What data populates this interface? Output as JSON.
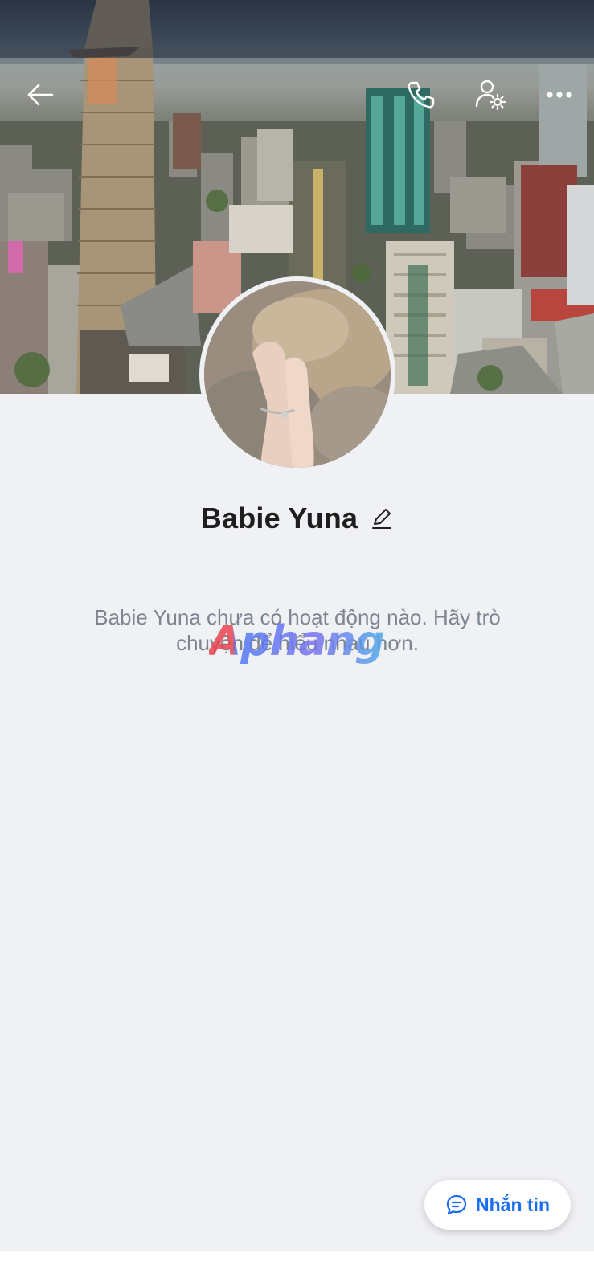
{
  "profile": {
    "name": "Babie Yuna",
    "empty_message": "Babie Yuna chưa có hoạt động nào. Hãy trò chuyện để hiểu nhau hơn."
  },
  "toolbar": {
    "back_icon": "arrow-left-icon",
    "call_icon": "phone-icon",
    "settings_icon": "user-settings-icon",
    "more_icon": "more-dots-icon"
  },
  "actions": {
    "message_label": "Nhắn tin",
    "message_icon": "chat-bubble-icon"
  },
  "watermark": {
    "text": "Aphang"
  },
  "colors": {
    "accent": "#1a6ef0",
    "background": "#f0f1f5",
    "name_text": "#1e1e1e",
    "muted_text": "#7d8590"
  }
}
